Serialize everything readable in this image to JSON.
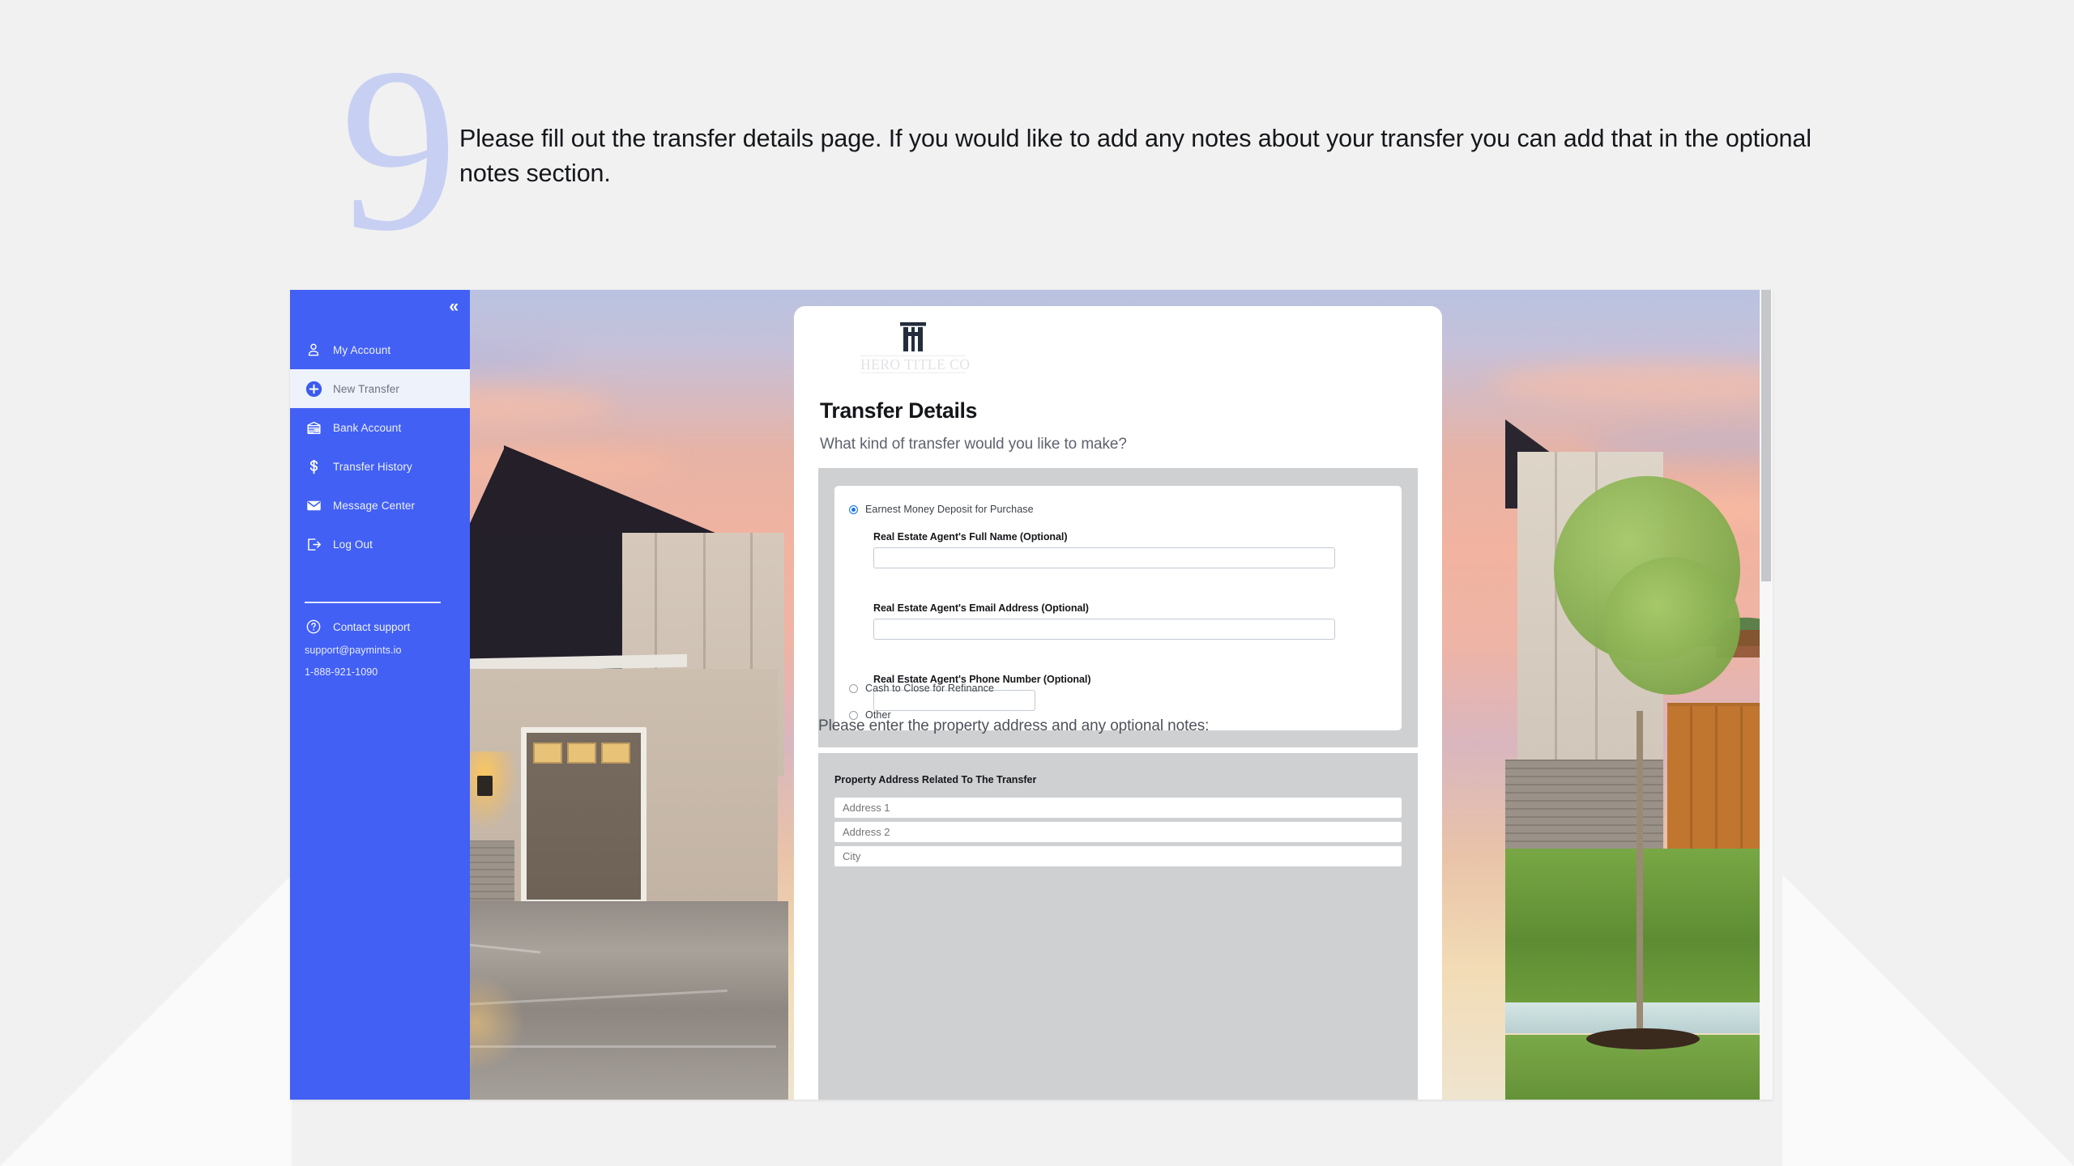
{
  "step": {
    "number": "9",
    "instruction": "Please fill out the transfer details page. If you would like to add any notes about your transfer you can add that in the optional notes section."
  },
  "colors": {
    "sidebar_blue": "#4260f4",
    "step_number_blue": "#c7d0f2",
    "panel_gray": "#cfd0d2",
    "radio_selected_blue": "#1b78e8",
    "page_background": "#f1f1f2"
  },
  "sidebar": {
    "collapse_label": "«",
    "collapse_icon": "chevron-double-left-icon",
    "items": [
      {
        "label": "My Account",
        "icon": "user-icon",
        "active": false
      },
      {
        "label": "New Transfer",
        "icon": "plus-circle-icon",
        "active": true
      },
      {
        "label": "Bank Account",
        "icon": "bank-icon",
        "active": false
      },
      {
        "label": "Transfer History",
        "icon": "dollar-icon",
        "active": false
      },
      {
        "label": "Message Center",
        "icon": "envelope-icon",
        "active": false
      },
      {
        "label": "Log Out",
        "icon": "logout-icon",
        "active": false
      }
    ],
    "support": {
      "label": "Contact support",
      "icon": "question-circle-icon",
      "email": "support@paymints.io",
      "phone": "1-888-921-1090"
    }
  },
  "card": {
    "brand": {
      "mark_icon": "hero-title-monogram-icon",
      "name": "HERO TITLE CO"
    },
    "title": "Transfer Details",
    "question": "What kind of transfer would you like to make?",
    "transfer_types": [
      {
        "label": "Earnest Money Deposit for Purchase",
        "checked": true
      },
      {
        "label": "Cash to Close for Refinance",
        "checked": false
      },
      {
        "label": "Other",
        "checked": false
      }
    ],
    "agent_fields": [
      {
        "label": "Real Estate Agent's Full Name (Optional)",
        "value": ""
      },
      {
        "label": "Real Estate Agent's Email Address (Optional)",
        "value": ""
      },
      {
        "label": "Real Estate Agent's Phone Number (Optional)",
        "value": ""
      }
    ],
    "address_heading": "Please enter the property address and any optional notes:",
    "address_section_title": "Property Address Related To The Transfer",
    "address_fields": [
      {
        "placeholder": "Address 1",
        "value": ""
      },
      {
        "placeholder": "Address 2",
        "value": ""
      },
      {
        "placeholder": "City",
        "value": ""
      }
    ]
  }
}
